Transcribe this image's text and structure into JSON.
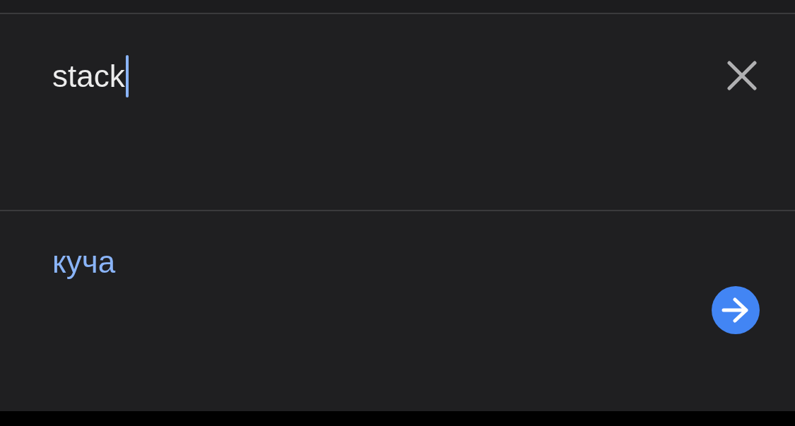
{
  "input": {
    "value": "stack",
    "focused": true
  },
  "result": {
    "translation": "куча"
  }
}
